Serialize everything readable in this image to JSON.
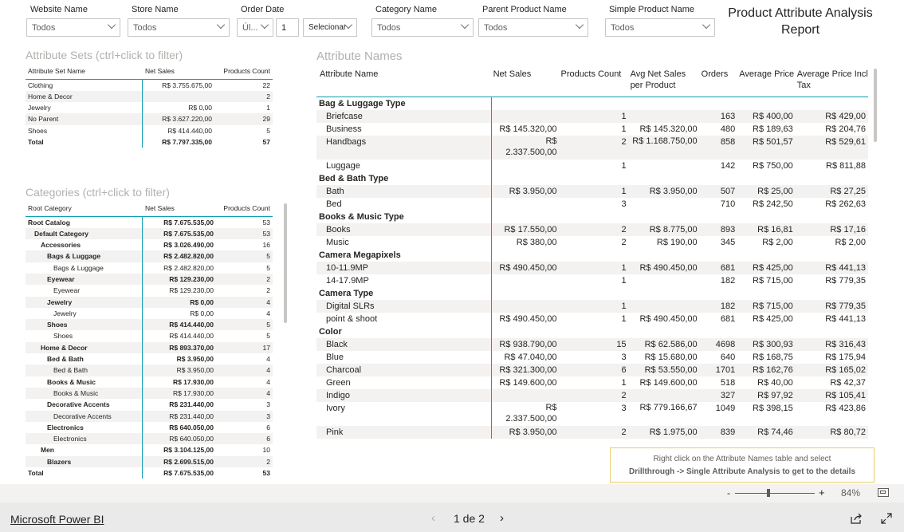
{
  "filters": [
    {
      "label": "Website Name",
      "value": "Todos"
    },
    {
      "label": "Store Name",
      "value": "Todos"
    },
    {
      "label": "Order Date",
      "value": "Úl...",
      "num": "1",
      "unit": "Selecionar"
    },
    {
      "label": "Category Name",
      "value": "Todos"
    },
    {
      "label": "Parent Product Name",
      "value": "Todos"
    },
    {
      "label": "Simple Product Name",
      "value": "Todos"
    }
  ],
  "report_title": "Product Attribute Analysis Report",
  "attribute_sets": {
    "title": "Attribute Sets (ctrl+click to filter)",
    "headers": [
      "Attribute Set Name",
      "Net Sales",
      "Products Count"
    ],
    "rows": [
      [
        "Clothing",
        "R$ 3.755.675,00",
        "22"
      ],
      [
        "Home & Decor",
        "",
        "2"
      ],
      [
        "Jewelry",
        "R$ 0,00",
        "1"
      ],
      [
        "No Parent",
        "R$ 3.627.220,00",
        "29"
      ],
      [
        "Shoes",
        "R$ 414.440,00",
        "5"
      ]
    ],
    "total": [
      "Total",
      "R$ 7.797.335,00",
      "57"
    ]
  },
  "categories": {
    "title": "Categories (ctrl+click to filter)",
    "headers": [
      "Root Category",
      "Net Sales",
      "Products Count"
    ],
    "rows": [
      {
        "lvl": 0,
        "b": true,
        "name": "Root Catalog",
        "sales": "R$ 7.675.535,00",
        "count": "53"
      },
      {
        "lvl": 1,
        "b": true,
        "name": "Default Category",
        "sales": "R$ 7.675.535,00",
        "count": "53"
      },
      {
        "lvl": 2,
        "b": true,
        "name": "Accessories",
        "sales": "R$ 3.026.490,00",
        "count": "16"
      },
      {
        "lvl": 3,
        "b": true,
        "name": "Bags & Luggage",
        "sales": "R$ 2.482.820,00",
        "count": "5"
      },
      {
        "lvl": 4,
        "b": false,
        "name": "Bags & Luggage",
        "sales": "R$ 2.482.820,00",
        "count": "5"
      },
      {
        "lvl": 3,
        "b": true,
        "name": "Eyewear",
        "sales": "R$ 129.230,00",
        "count": "2"
      },
      {
        "lvl": 4,
        "b": false,
        "name": "Eyewear",
        "sales": "R$ 129.230,00",
        "count": "2"
      },
      {
        "lvl": 3,
        "b": true,
        "name": "Jewelry",
        "sales": "R$ 0,00",
        "count": "4"
      },
      {
        "lvl": 4,
        "b": false,
        "name": "Jewelry",
        "sales": "R$ 0,00",
        "count": "4"
      },
      {
        "lvl": 3,
        "b": true,
        "name": "Shoes",
        "sales": "R$ 414.440,00",
        "count": "5"
      },
      {
        "lvl": 4,
        "b": false,
        "name": "Shoes",
        "sales": "R$ 414.440,00",
        "count": "5"
      },
      {
        "lvl": 2,
        "b": true,
        "name": "Home & Decor",
        "sales": "R$ 893.370,00",
        "count": "17"
      },
      {
        "lvl": 3,
        "b": true,
        "name": "Bed & Bath",
        "sales": "R$ 3.950,00",
        "count": "4"
      },
      {
        "lvl": 4,
        "b": false,
        "name": "Bed & Bath",
        "sales": "R$ 3.950,00",
        "count": "4"
      },
      {
        "lvl": 3,
        "b": true,
        "name": "Books & Music",
        "sales": "R$ 17.930,00",
        "count": "4"
      },
      {
        "lvl": 4,
        "b": false,
        "name": "Books & Music",
        "sales": "R$ 17.930,00",
        "count": "4"
      },
      {
        "lvl": 3,
        "b": true,
        "name": "Decorative Accents",
        "sales": "R$ 231.440,00",
        "count": "3"
      },
      {
        "lvl": 4,
        "b": false,
        "name": "Decorative Accents",
        "sales": "R$ 231.440,00",
        "count": "3"
      },
      {
        "lvl": 3,
        "b": true,
        "name": "Electronics",
        "sales": "R$ 640.050,00",
        "count": "6"
      },
      {
        "lvl": 4,
        "b": false,
        "name": "Electronics",
        "sales": "R$ 640.050,00",
        "count": "6"
      },
      {
        "lvl": 2,
        "b": true,
        "name": "Men",
        "sales": "R$ 3.104.125,00",
        "count": "10"
      },
      {
        "lvl": 3,
        "b": true,
        "name": "Blazers",
        "sales": "R$ 2.699.515,00",
        "count": "2"
      }
    ],
    "total": [
      "Total",
      "R$ 7.675.535,00",
      "53"
    ]
  },
  "attribute_names": {
    "title": "Attribute Names",
    "headers": [
      "Attribute Name",
      "Net Sales",
      "Products Count",
      "Avg Net Sales per Product",
      "Orders",
      "Average Price",
      "Average Price Incl Tax"
    ],
    "rows": [
      {
        "g": true,
        "name": "Bag & Luggage Type"
      },
      {
        "name": "Briefcase",
        "sales": "",
        "count": "1",
        "avg": "",
        "orders": "163",
        "price": "R$ 400,00",
        "tax": "R$ 429,00"
      },
      {
        "name": "Business",
        "sales": "R$ 145.320,00",
        "count": "1",
        "avg": "R$ 145.320,00",
        "orders": "480",
        "price": "R$ 189,63",
        "tax": "R$ 204,76"
      },
      {
        "name": "Handbags",
        "sales": "R$ 2.337.500,00",
        "count": "2",
        "avg": "R$ 1.168.750,00",
        "orders": "858",
        "price": "R$ 501,57",
        "tax": "R$ 529,61",
        "tall": true
      },
      {
        "name": "Luggage",
        "sales": "",
        "count": "1",
        "avg": "",
        "orders": "142",
        "price": "R$ 750,00",
        "tax": "R$ 811,88"
      },
      {
        "g": true,
        "name": "Bed & Bath Type"
      },
      {
        "name": "Bath",
        "sales": "R$ 3.950,00",
        "count": "1",
        "avg": "R$ 3.950,00",
        "orders": "507",
        "price": "R$ 25,00",
        "tax": "R$ 27,25"
      },
      {
        "name": "Bed",
        "sales": "",
        "count": "3",
        "avg": "",
        "orders": "710",
        "price": "R$ 242,50",
        "tax": "R$ 262,63"
      },
      {
        "g": true,
        "name": "Books & Music Type"
      },
      {
        "name": "Books",
        "sales": "R$ 17.550,00",
        "count": "2",
        "avg": "R$ 8.775,00",
        "orders": "893",
        "price": "R$ 16,81",
        "tax": "R$ 17,16"
      },
      {
        "name": "Music",
        "sales": "R$ 380,00",
        "count": "2",
        "avg": "R$ 190,00",
        "orders": "345",
        "price": "R$ 2,00",
        "tax": "R$ 2,00"
      },
      {
        "g": true,
        "name": "Camera Megapixels"
      },
      {
        "name": "10-11.9MP",
        "sales": "R$ 490.450,00",
        "count": "1",
        "avg": "R$ 490.450,00",
        "orders": "681",
        "price": "R$ 425,00",
        "tax": "R$ 441,13"
      },
      {
        "name": "14-17.9MP",
        "sales": "",
        "count": "1",
        "avg": "",
        "orders": "182",
        "price": "R$ 715,00",
        "tax": "R$ 779,35"
      },
      {
        "g": true,
        "name": "Camera Type"
      },
      {
        "name": "Digital SLRs",
        "sales": "",
        "count": "1",
        "avg": "",
        "orders": "182",
        "price": "R$ 715,00",
        "tax": "R$ 779,35"
      },
      {
        "name": "point & shoot",
        "sales": "R$ 490.450,00",
        "count": "1",
        "avg": "R$ 490.450,00",
        "orders": "681",
        "price": "R$ 425,00",
        "tax": "R$ 441,13"
      },
      {
        "g": true,
        "name": "Color"
      },
      {
        "name": "Black",
        "sales": "R$ 938.790,00",
        "count": "15",
        "avg": "R$ 62.586,00",
        "orders": "4698",
        "price": "R$ 300,93",
        "tax": "R$ 316,43"
      },
      {
        "name": "Blue",
        "sales": "R$ 47.040,00",
        "count": "3",
        "avg": "R$ 15.680,00",
        "orders": "640",
        "price": "R$ 168,75",
        "tax": "R$ 175,94"
      },
      {
        "name": "Charcoal",
        "sales": "R$ 321.300,00",
        "count": "6",
        "avg": "R$ 53.550,00",
        "orders": "1701",
        "price": "R$ 162,76",
        "tax": "R$ 165,02"
      },
      {
        "name": "Green",
        "sales": "R$ 149.600,00",
        "count": "1",
        "avg": "R$ 149.600,00",
        "orders": "518",
        "price": "R$ 40,00",
        "tax": "R$ 42,37"
      },
      {
        "name": "Indigo",
        "sales": "",
        "count": "2",
        "avg": "",
        "orders": "327",
        "price": "R$ 97,92",
        "tax": "R$ 105,41"
      },
      {
        "name": "Ivory",
        "sales": "R$ 2.337.500,00",
        "count": "3",
        "avg": "R$ 779.166,67",
        "orders": "1049",
        "price": "R$ 398,15",
        "tax": "R$ 423,86",
        "tall": true
      },
      {
        "name": "Pink",
        "sales": "R$ 3.950,00",
        "count": "2",
        "avg": "R$ 1.975,00",
        "orders": "839",
        "price": "R$ 74,46",
        "tax": "R$ 80,72"
      }
    ]
  },
  "note": {
    "line1": "Right click on the Attribute Names table and select",
    "line2": "Drillthrough -> Single Attribute Analysis to get to the details"
  },
  "zoom": {
    "minus": "-",
    "plus": "+",
    "percent": "84%"
  },
  "footer": {
    "brand": "Microsoft Power BI",
    "page": "1 de 2"
  }
}
